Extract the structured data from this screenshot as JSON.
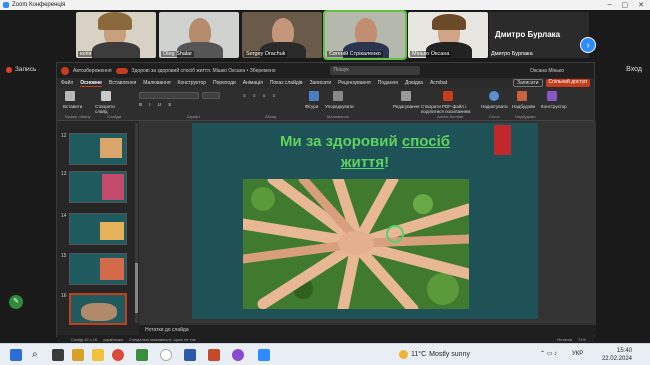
{
  "zoom": {
    "window_title": "Zoom Конференція",
    "record_label": "Запись",
    "enter_label": "Вход",
    "participants": [
      "юлія",
      "Oleg Shalar",
      "Sergey Drachuk",
      "Євгеній Стрікаленко",
      "Мінько Оксана"
    ],
    "featured_name": "Дмитро Бурлака",
    "featured_label": "Дмитро Бурлака",
    "next_icon": "chevron-right-icon"
  },
  "ppt": {
    "doc_title": "Здорові за здоровий спосіб життя. Мішко Оксана • Збережено",
    "autosave_label": "Автозбереження",
    "search_placeholder": "Пошук",
    "user_name": "Оксана Мінько",
    "menu": [
      "Файл",
      "Основне",
      "Вставлення",
      "Малювання",
      "Конструктор",
      "Переходи",
      "Анімація",
      "Показ слайдів",
      "Записати",
      "Рецензування",
      "Подання",
      "Довідка",
      "Acrobat"
    ],
    "menu_selected": "Основне",
    "record_btn": "Записати",
    "share_btn": "Спільний доступ",
    "ribbon": {
      "paste": "Вставити",
      "new_slide": "Створити слайд",
      "clipboard": "Буфер обміну",
      "slides": "Слайди",
      "font": "Шрифт",
      "paragraph": "Абзац",
      "drawing": "Малювання",
      "shapes": "Фігури",
      "arrange": "Упорядкувати",
      "editing": "Редагування",
      "pdf": "Створити PDF-файл і поділитися посиланням",
      "adobe": "Adobe Acrobat",
      "dictate": "Надиктувати",
      "voice": "Голос",
      "designer": "Конструктор",
      "addins": "Надбудови",
      "addins2": "Надбудови"
    },
    "slide_numbers": [
      "12",
      "13",
      "14",
      "15",
      "16"
    ],
    "slide": {
      "title_line1": "Ми за здоровий",
      "title_underlined": "спосіб",
      "title_line2": "життя",
      "title_end": "!"
    },
    "notes_label": "Нотатки до слайда",
    "status": [
      "Слайд 16 з 16",
      "українська",
      "Спеціальні можливості: щось не так"
    ],
    "status_right": [
      "Нотатки",
      "71%"
    ]
  },
  "taskbar": {
    "weather_temp": "11°C",
    "weather_text": "Mostly sunny",
    "lang": "УКР",
    "time": "15:40",
    "date": "22.02.2024"
  },
  "colors": {
    "accent_red": "#c43e1c",
    "slide_bg": "#1e5257",
    "title_green": "#5fd35f",
    "zoom_blue": "#2d8cff"
  }
}
